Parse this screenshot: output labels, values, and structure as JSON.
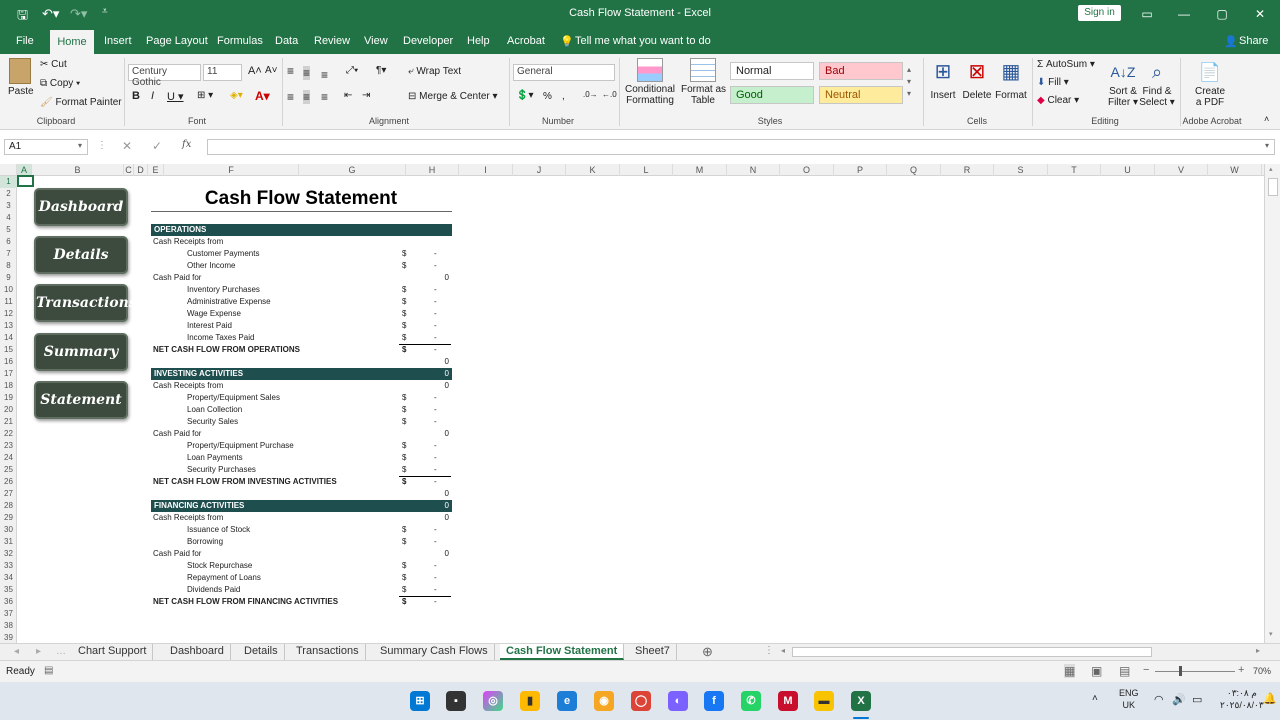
{
  "window": {
    "title": "Cash Flow Statement  -  Excel",
    "sign_in": "Sign in",
    "share": "Share"
  },
  "menu": {
    "file": "File",
    "home": "Home",
    "insert": "Insert",
    "page_layout": "Page Layout",
    "formulas": "Formulas",
    "data": "Data",
    "review": "Review",
    "view": "View",
    "developer": "Developer",
    "help": "Help",
    "acrobat": "Acrobat",
    "tell": "Tell me what you want to do"
  },
  "ribbon": {
    "clipboard": {
      "paste": "Paste",
      "cut": "Cut",
      "copy": "Copy",
      "format_painter": "Format Painter",
      "label": "Clipboard"
    },
    "font": {
      "name": "Century Gothic",
      "size": "11",
      "label": "Font"
    },
    "alignment": {
      "wrap": "Wrap Text",
      "merge": "Merge & Center",
      "label": "Alignment"
    },
    "number": {
      "format": "General",
      "label": "Number"
    },
    "styles": {
      "conditional": "Conditional",
      "formatting": "Formatting",
      "format_as": "Format as",
      "table": "Table",
      "normal": "Normal",
      "bad": "Bad",
      "good": "Good",
      "neutral": "Neutral",
      "label": "Styles"
    },
    "cells": {
      "insert": "Insert",
      "delete": "Delete",
      "format": "Format",
      "label": "Cells"
    },
    "editing": {
      "autosum": "AutoSum",
      "fill": "Fill",
      "clear": "Clear",
      "sort": "Sort &",
      "filter": "Filter",
      "find": "Find &",
      "select": "Select",
      "label": "Editing"
    },
    "acrobat": {
      "create": "Create",
      "pdf": "a PDF",
      "label": "Adobe Acrobat"
    },
    "colors": {
      "bad_bg": "#ffc7ce",
      "bad_fg": "#9c0006",
      "good_bg": "#c6efce",
      "good_fg": "#006100",
      "neutral_bg": "#ffeb9c",
      "neutral_fg": "#9c5700"
    }
  },
  "namebox": "A1",
  "fx": "fx",
  "columns": [
    "A",
    "B",
    "C",
    "D",
    "E",
    "F",
    "G",
    "H",
    "I",
    "J",
    "K",
    "L",
    "M",
    "N",
    "O",
    "P",
    "Q",
    "R",
    "S",
    "T",
    "U",
    "V",
    "W"
  ],
  "rows": [
    "1",
    "2",
    "3",
    "4",
    "5",
    "6",
    "7",
    "8",
    "9",
    "10",
    "11",
    "12",
    "13",
    "14",
    "15",
    "16",
    "17",
    "18",
    "19",
    "20",
    "21",
    "22",
    "23",
    "24",
    "25",
    "26",
    "27",
    "28",
    "29",
    "30",
    "31",
    "32",
    "33",
    "34",
    "35",
    "36",
    "37",
    "38",
    "39"
  ],
  "nav_buttons": [
    "Dashboard",
    "Details",
    "Transactions",
    "Summary",
    "Statement"
  ],
  "statement": {
    "title": "Cash Flow Statement",
    "sections": [
      {
        "header": "OPERATIONS",
        "header_value": "",
        "receipts_label": "Cash Receipts from",
        "receipts_value": "",
        "receipts": [
          "Customer Payments",
          "Other Income"
        ],
        "paid_label": "Cash Paid for",
        "paid_value": "0",
        "paid": [
          "Inventory Purchases",
          "Administrative Expense",
          "Wage Expense",
          "Interest Paid",
          "Income Taxes Paid"
        ],
        "net": "NET CASH FLOW FROM OPERATIONS",
        "after_net": "0"
      },
      {
        "header": "INVESTING ACTIVITIES",
        "header_value": "0",
        "receipts_label": "Cash Receipts from",
        "receipts_value": "0",
        "receipts": [
          "Property/Equipment Sales",
          "Loan Collection",
          "Security Sales"
        ],
        "paid_label": "Cash Paid for",
        "paid_value": "0",
        "paid": [
          "Property/Equipment Purchase",
          "Loan Payments",
          "Security Purchases"
        ],
        "net": "NET CASH FLOW FROM INVESTING ACTIVITIES",
        "after_net": "0"
      },
      {
        "header": "FINANCING ACTIVITIES",
        "header_value": "0",
        "receipts_label": "Cash Receipts from",
        "receipts_value": "0",
        "receipts": [
          "Issuance of Stock",
          "Borrowing"
        ],
        "paid_label": "Cash Paid for",
        "paid_value": "0",
        "paid": [
          "Stock Repurchase",
          "Repayment of Loans",
          "Dividends Paid"
        ],
        "net": "NET CASH FLOW FROM FINANCING ACTIVITIES",
        "after_net": ""
      }
    ],
    "dollar": "$",
    "dash": "-"
  },
  "sheet_tabs": [
    "Chart Support",
    "Dashboard",
    "Details",
    "Transactions",
    "Summary Cash Flows",
    "Cash Flow Statement",
    "Sheet7"
  ],
  "status": {
    "ready": "Ready",
    "zoom": "70%"
  },
  "taskbar": {
    "lang1": "ENG",
    "lang2": "UK",
    "time": "م ٠٣:٠٨",
    "date": "٢٠٢٥/٠٨/٠٣"
  }
}
